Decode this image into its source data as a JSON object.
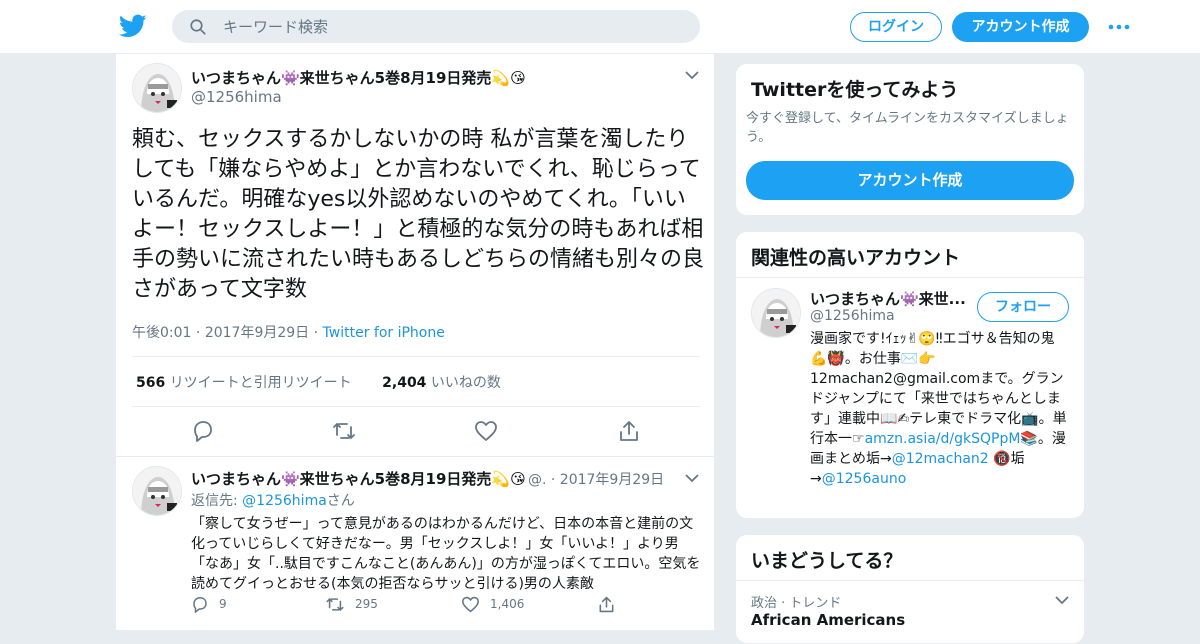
{
  "header": {
    "logo_icon": "twitter-bird-icon",
    "search_placeholder": "キーワード検索",
    "login_label": "ログイン",
    "signup_label": "アカウント作成",
    "more_icon": "more-dots-icon",
    "accent": "#1da1f2"
  },
  "tweet": {
    "display_name": "いつまちゃん👾来世ちゃん5巻8月19日発売💫😘",
    "handle": "@1256hima",
    "text": "頼む、セックスするかしないかの時 私が言葉を濁したりしても「嫌ならやめよ」とか言わないでくれ、恥じらっているんだ。明確なyes以外認めないのやめてくれ。「いいよー！セックスしよー！」と積極的な気分の時もあれば相手の勢いに流されたい時もあるしどちらの情緒も別々の良さがあって文字数",
    "time": "午後0:01",
    "date": "2017年9月29日",
    "source": "Twitter for iPhone",
    "separator": "·",
    "retweet_count": "566",
    "retweet_label": "リツイートと引用リツイート",
    "like_count": "2,404",
    "like_label": "いいねの数"
  },
  "reply": {
    "display_name": "いつまちゃん👾来世ちゃん5巻8月19日発売💫😘",
    "handle_date": "@. · 2017年9月29日",
    "reply_to_label": "返信先:",
    "reply_to_handle": "@1256hima",
    "reply_to_suffix": "さん",
    "text": "「察して女うぜー」って意見があるのはわかるんだけど、日本の本音と建前の文化っていじらしくて好きだなー。男「セックスしよ！」女「いいよ！」より男「なあ」女「..駄目ですこんなこと(あんあん)」の方が湿っぽくてエロい。空気を読めてグイっとおせる(本気の拒否ならサッと引ける)男の人素敵",
    "reply_count": "9",
    "retweet_count": "295",
    "like_count": "1,406"
  },
  "signup_card": {
    "title": "Twitterを使ってみよう",
    "subtitle": "今すぐ登録して、タイムラインをカスタマイズしましょう。",
    "button": "アカウント作成"
  },
  "related_card": {
    "title": "関連性の高いアカウント",
    "name": "いつまちゃん👾来世...",
    "handle": "@1256hima",
    "follow": "フォロー",
    "bio_1": "漫画家です!ｲｪｯ✌🙄‼エゴサ＆告知の鬼💪👹。お仕事✉️👉12machan2@gmail.comまで。グランドジャンプにて「来世ではちゃんとします」連載中📖✍テレ東でドラマ化📺。単行本一☞",
    "bio_link_1": "amzn.asia/d/gkSQPpM",
    "bio_2": "📚。漫画まとめ垢→",
    "bio_link_2": "@12machan2",
    "bio_3": " 🔞垢→",
    "bio_link_3": "@1256auno"
  },
  "trends_card": {
    "title": "いまどうしてる？",
    "category": "政治 · トレンド",
    "trend": "African Americans"
  }
}
